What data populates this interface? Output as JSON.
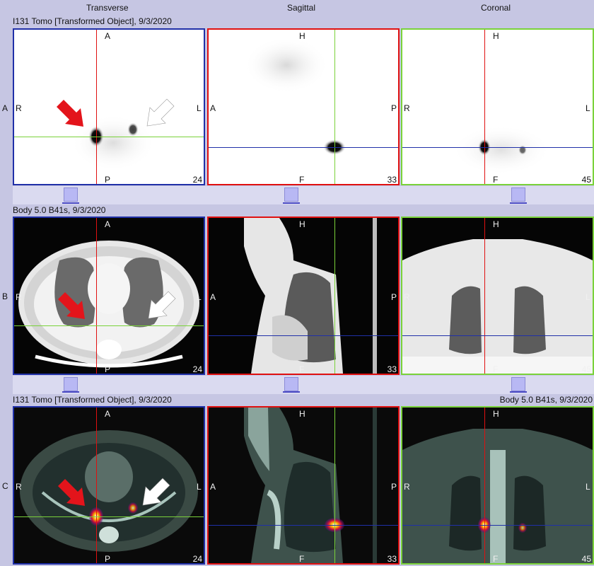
{
  "columns": {
    "transverse": "Transverse",
    "sagittal": "Sagittal",
    "coronal": "Coronal"
  },
  "rows": {
    "a": {
      "letter": "A",
      "title": "I131 Tomo [Transformed Object], 9/3/2020"
    },
    "b": {
      "letter": "B",
      "title": "Body  5.0  B41s, 9/3/2020"
    },
    "c": {
      "letter": "C",
      "title_left": "I131 Tomo [Transformed Object], 9/3/2020",
      "title_right": "Body  5.0  B41s, 9/3/2020"
    }
  },
  "orientation": {
    "transverse": {
      "top": "A",
      "bottom": "P",
      "left": "R",
      "right": "L"
    },
    "sagittal": {
      "top": "H",
      "bottom": "F",
      "left": "A",
      "right": "P"
    },
    "coronal": {
      "top": "H",
      "bottom": "F",
      "left": "R",
      "right": "L"
    }
  },
  "slice_numbers": {
    "transverse": "24",
    "sagittal": "33",
    "coronal": "45"
  },
  "colors": {
    "crosshair_red": "#e01010",
    "crosshair_green": "#7ad23a",
    "crosshair_blue": "#2030a8",
    "arrow_red": "#e3141b",
    "arrow_white": "#ffffff",
    "toolbar_bg": "#c6c6e3"
  },
  "icons": {
    "slider_handle": "slider-handle-icon",
    "red_arrow": "red-arrow-icon",
    "white_arrow": "white-arrow-icon"
  }
}
